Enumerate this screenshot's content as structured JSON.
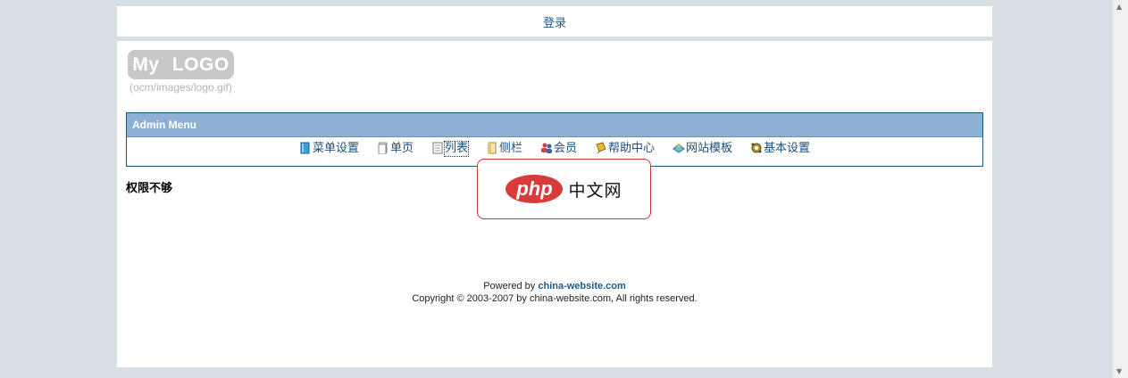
{
  "topbar": {
    "login_label": "登录"
  },
  "logo": {
    "text": "My  LOGO",
    "path": "(ocm/images/logo.gif)"
  },
  "admin_menu": {
    "title": "Admin Menu",
    "items": [
      {
        "label": "菜单设置",
        "icon": "book-icon"
      },
      {
        "label": "单页",
        "icon": "page-icon"
      },
      {
        "label": "列表",
        "icon": "list-icon"
      },
      {
        "label": "侧栏",
        "icon": "sidebar-icon"
      },
      {
        "label": "会员",
        "icon": "users-icon"
      },
      {
        "label": "帮助中心",
        "icon": "help-icon"
      },
      {
        "label": "网站模板",
        "icon": "template-icon"
      },
      {
        "label": "基本设置",
        "icon": "settings-icon"
      }
    ]
  },
  "message": "权限不够",
  "footer": {
    "powered_prefix": "Powered by ",
    "powered_link": "china-website.com",
    "copyright": "Copyright © 2003-2007 by china-website.com, All rights reserved."
  },
  "overlay": {
    "badge": "php",
    "text": "中文网"
  },
  "colors": {
    "page_bg": "#d6dfe3",
    "menu_header": "#8fb0d6",
    "link": "#1d5b8a",
    "overlay_accent": "#d93a3a"
  }
}
